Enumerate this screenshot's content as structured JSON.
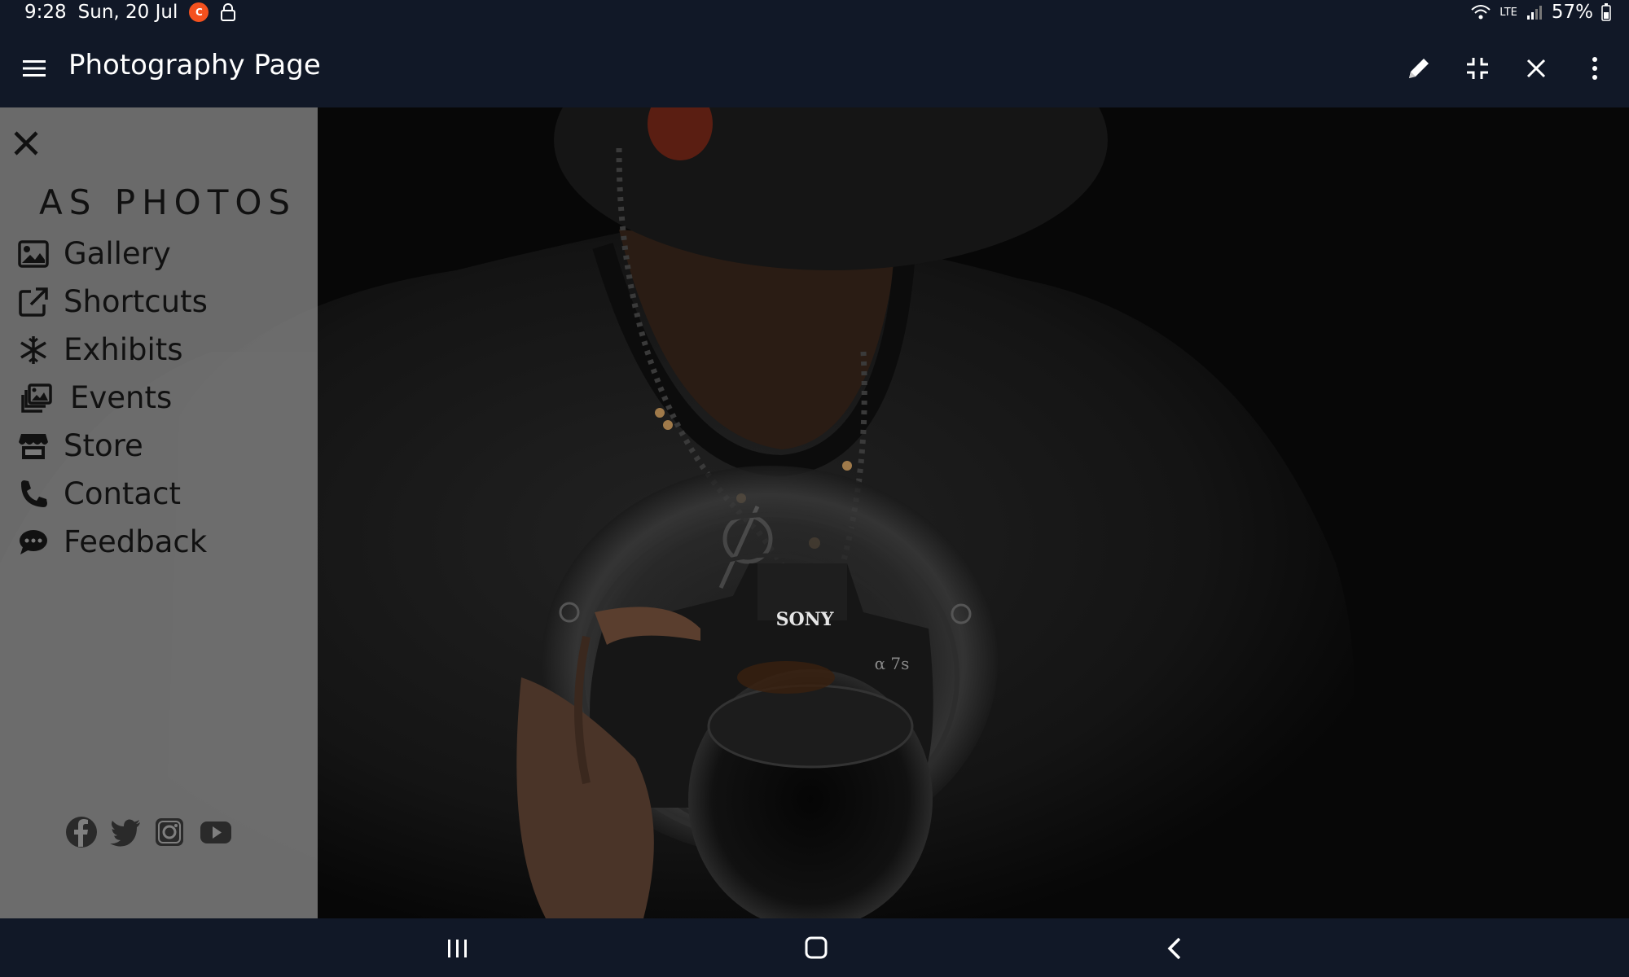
{
  "status": {
    "time": "9:28",
    "date": "Sun, 20 Jul",
    "battery": "57%",
    "network": "LTE"
  },
  "appbar": {
    "title": "Photography Page"
  },
  "sidebar": {
    "brand": "AS PHOTOS",
    "items": [
      {
        "label": "Gallery",
        "icon": "image-icon"
      },
      {
        "label": "Shortcuts",
        "icon": "external-link-icon"
      },
      {
        "label": "Exhibits",
        "icon": "snowflake-icon"
      },
      {
        "label": "Events",
        "icon": "photos-stack-icon"
      },
      {
        "label": "Store",
        "icon": "store-icon"
      },
      {
        "label": "Contact",
        "icon": "phone-icon"
      },
      {
        "label": "Feedback",
        "icon": "chat-icon"
      }
    ],
    "social": [
      "facebook-icon",
      "twitter-icon",
      "instagram-icon",
      "youtube-icon"
    ]
  },
  "photo": {
    "camera_brand": "SONY",
    "camera_model": "α 7s"
  },
  "colors": {
    "system_bar": "#111827",
    "sidebar_bg": "#808080",
    "sidebar_text": "#111111"
  }
}
